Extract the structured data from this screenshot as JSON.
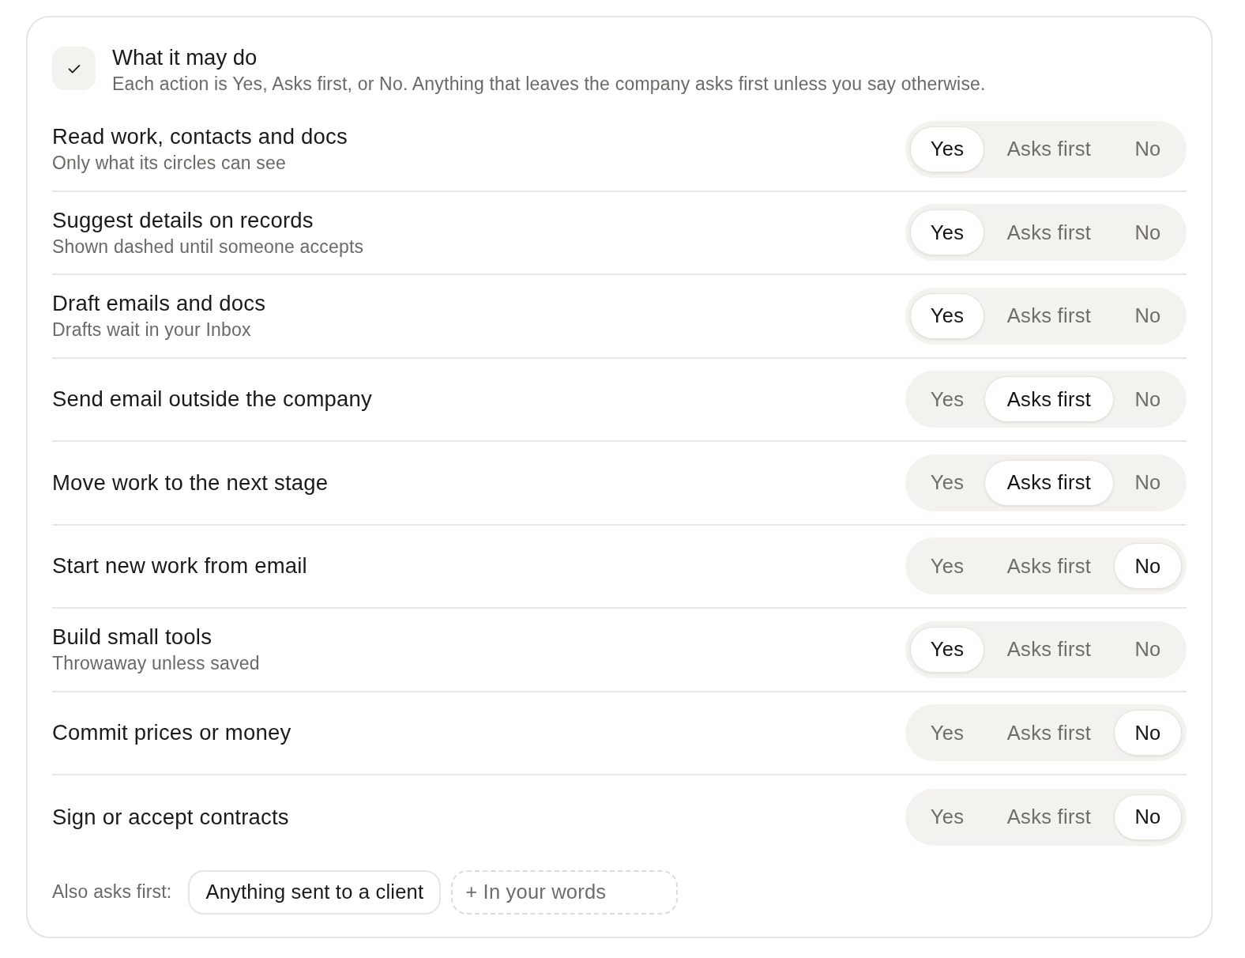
{
  "header": {
    "title": "What it may do",
    "subtitle": "Each action is Yes, Asks first, or No. Anything that leaves the company asks first unless you say otherwise."
  },
  "actions": [
    {
      "title": "Read work, contacts and docs",
      "subtitle": "Only what its circles can see",
      "options": [
        {
          "label": "Yes",
          "selected": true
        },
        {
          "label": "Asks first",
          "selected": false
        },
        {
          "label": "No",
          "selected": false
        }
      ]
    },
    {
      "title": "Suggest details on records",
      "subtitle": "Shown dashed until someone accepts",
      "options": [
        {
          "label": "Yes",
          "selected": true
        },
        {
          "label": "Asks first",
          "selected": false
        },
        {
          "label": "No",
          "selected": false
        }
      ]
    },
    {
      "title": "Draft emails and docs",
      "subtitle": "Drafts wait in your Inbox",
      "options": [
        {
          "label": "Yes",
          "selected": true
        },
        {
          "label": "Asks first",
          "selected": false
        },
        {
          "label": "No",
          "selected": false
        }
      ]
    },
    {
      "title": "Send email outside the company",
      "options": [
        {
          "label": "Yes",
          "selected": false
        },
        {
          "label": "Asks first",
          "selected": true
        },
        {
          "label": "No",
          "selected": false
        }
      ]
    },
    {
      "title": "Move work to the next stage",
      "options": [
        {
          "label": "Yes",
          "selected": false
        },
        {
          "label": "Asks first",
          "selected": true
        },
        {
          "label": "No",
          "selected": false
        }
      ]
    },
    {
      "title": "Start new work from email",
      "options": [
        {
          "label": "Yes",
          "selected": false
        },
        {
          "label": "Asks first",
          "selected": false
        },
        {
          "label": "No",
          "selected": true
        }
      ]
    },
    {
      "title": "Build small tools",
      "subtitle": "Throwaway unless saved",
      "options": [
        {
          "label": "Yes",
          "selected": true
        },
        {
          "label": "Asks first",
          "selected": false
        },
        {
          "label": "No",
          "selected": false
        }
      ]
    },
    {
      "title": "Commit prices or money",
      "options": [
        {
          "label": "Yes",
          "selected": false
        },
        {
          "label": "Asks first",
          "selected": false
        },
        {
          "label": "No",
          "selected": true
        }
      ]
    },
    {
      "title": "Sign or accept contracts",
      "options": [
        {
          "label": "Yes",
          "selected": false
        },
        {
          "label": "Asks first",
          "selected": false
        },
        {
          "label": "No",
          "selected": true
        }
      ]
    }
  ],
  "also_asks_first": {
    "label": "Also asks first:",
    "chips": [
      "Anything sent to a client"
    ],
    "add_button": "+ In your words"
  }
}
